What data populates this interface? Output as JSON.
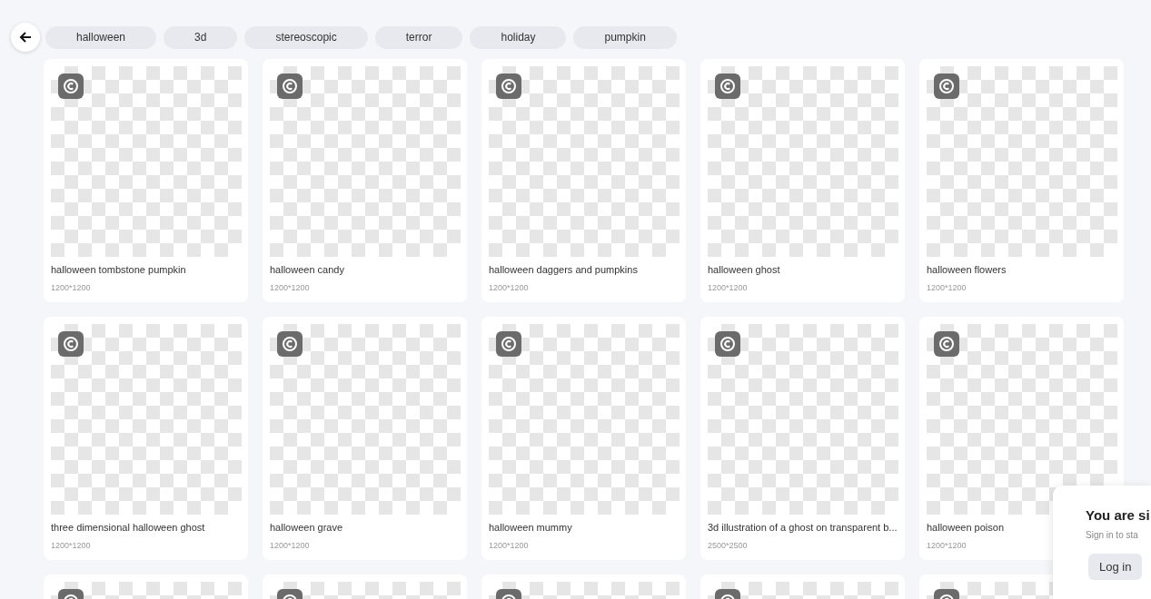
{
  "tags": [
    {
      "label": "halloween"
    },
    {
      "label": "3d"
    },
    {
      "label": "stereoscopic"
    },
    {
      "label": "terror"
    },
    {
      "label": "holiday"
    },
    {
      "label": "pumpkin"
    }
  ],
  "cards": [
    {
      "title": "halloween tombstone pumpkin",
      "size": "1200*1200",
      "copyright": true
    },
    {
      "title": "halloween candy",
      "size": "1200*1200",
      "copyright": true
    },
    {
      "title": "halloween daggers and pumpkins",
      "size": "1200*1200",
      "copyright": true
    },
    {
      "title": "halloween ghost",
      "size": "1200*1200",
      "copyright": true
    },
    {
      "title": "halloween flowers",
      "size": "1200*1200",
      "copyright": true
    },
    {
      "title": "three dimensional halloween ghost",
      "size": "1200*1200",
      "copyright": true
    },
    {
      "title": "halloween grave",
      "size": "1200*1200",
      "copyright": true
    },
    {
      "title": "halloween mummy",
      "size": "1200*1200",
      "copyright": true
    },
    {
      "title": "3d illustration of a ghost on transparent b...",
      "size": "2500*2500",
      "copyright": true
    },
    {
      "title": "halloween poison",
      "size": "1200*1200",
      "copyright": true
    },
    {
      "copyright": true
    },
    {
      "copyright": true
    },
    {
      "copyright": true
    },
    {
      "copyright": true
    },
    {
      "copyright": true
    }
  ],
  "signin_popup": {
    "title": "You are si",
    "text": "Sign in to sta",
    "button": "Log in"
  }
}
